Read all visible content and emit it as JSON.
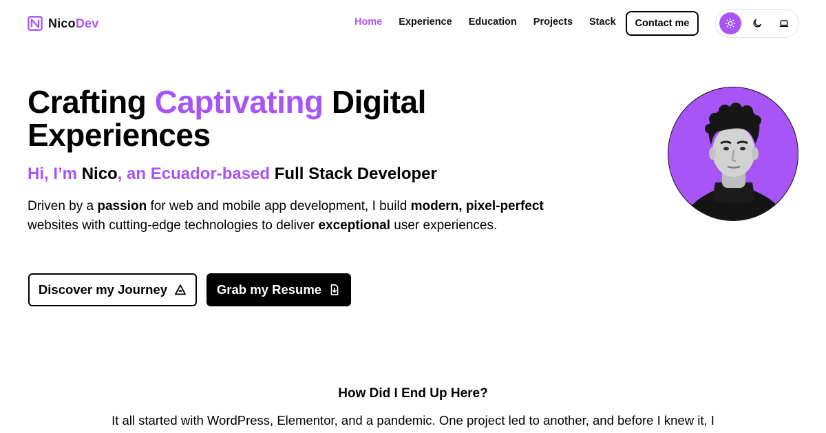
{
  "nav": {
    "logo": {
      "part1": "Nico",
      "part2": "Dev"
    },
    "links": [
      {
        "label": "Home",
        "active": true
      },
      {
        "label": "Experience",
        "active": false
      },
      {
        "label": "Education",
        "active": false
      },
      {
        "label": "Projects",
        "active": false
      },
      {
        "label": "Stack",
        "active": false
      }
    ],
    "contact_label": "Contact me",
    "theme_options": [
      {
        "icon": "sun-icon",
        "selected": true
      },
      {
        "icon": "moon-icon",
        "selected": false
      },
      {
        "icon": "laptop-icon",
        "selected": false
      }
    ]
  },
  "hero": {
    "title_part1": "Crafting ",
    "title_accent": "Captivating",
    "title_part2": " Digital Experiences",
    "sub_1": "Hi, I’m ",
    "sub_2": "Nico",
    "sub_3": ", an Ecuador-based ",
    "sub_4": "Full Stack Developer",
    "desc": [
      {
        "text": "Driven by a ",
        "bold": false
      },
      {
        "text": "passion",
        "bold": true
      },
      {
        "text": " for web and mobile app development, I build ",
        "bold": false
      },
      {
        "text": "modern, pixel-perfect",
        "bold": true
      },
      {
        "text": " websites with cutting-edge technologies to deliver ",
        "bold": false
      },
      {
        "text": "exceptional",
        "bold": true
      },
      {
        "text": " user experiences.",
        "bold": false
      }
    ],
    "journey_button": "Discover my Journey",
    "resume_button": "Grab my Resume",
    "accent_color": "#a855f7"
  },
  "story": {
    "title": "How Did I End Up Here?",
    "text": "It all started with WordPress, Elementor, and a pandemic. One project led to another, and before I knew it, I"
  }
}
